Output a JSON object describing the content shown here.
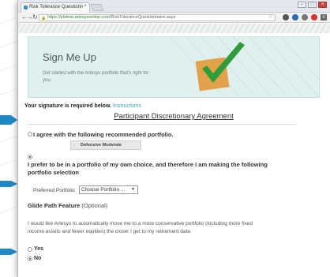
{
  "browser": {
    "tab_title": "Risk Tolerance Questionn",
    "url_host": "https://plotme.artesysonline.com",
    "url_path": "/RiskToleranceQuestionnaire.aspx"
  },
  "hero": {
    "title": "Sign Me Up",
    "subtitle": "Get started with the Artesys portfolio that's right for you."
  },
  "signature": {
    "required_text": "Your signature is required below.",
    "instructions_link": "Instructions"
  },
  "agreement": {
    "title": "Participant Discretionary Agreement",
    "option_recommended": "I agree with the following recommended portfolio.",
    "recommended_portfolio": "Defensive Moderate",
    "option_own_choice": "I prefer to be in a portfolio of my own choice, and therefore I am making the following portfolio selection",
    "preferred_label": "Preferred Portfolio",
    "preferred_value": "Choose Portfolio ..."
  },
  "glide_path": {
    "title": "Glide Path Feature",
    "optional": "(Optional)",
    "description": "I would like Artesys to automatically move me to a more conservative portfolio (including more fixed income assets and fewer equities) the closer I get to my retirement date.",
    "yes_label": "Yes",
    "no_label": "No",
    "selected": "No"
  },
  "colors": {
    "accent": "#3aa3b5",
    "hero_bg": "#dff0ee",
    "check_green": "#2f9e3a",
    "check_box": "#e2a14a",
    "marker_blue": "#1e88c7"
  }
}
